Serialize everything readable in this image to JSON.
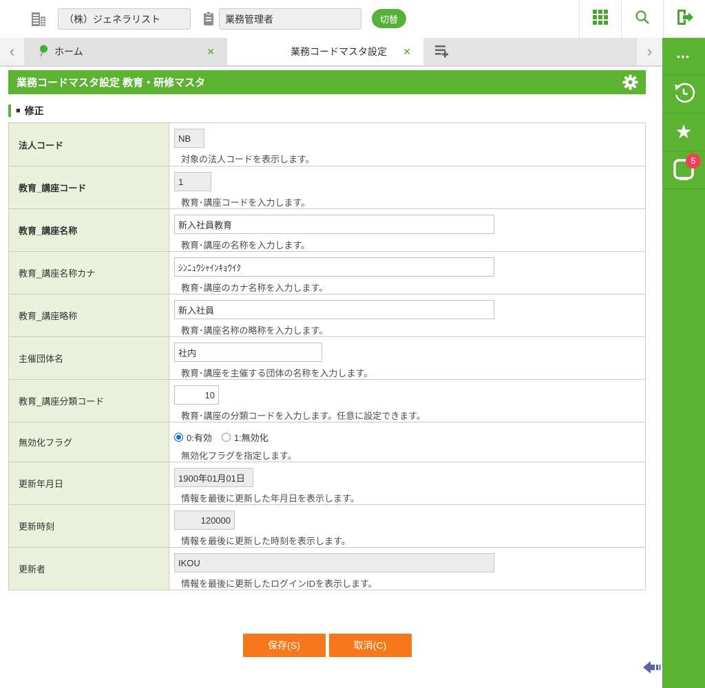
{
  "header": {
    "company_value": "（株）ジェネラリスト",
    "role_value": "業務管理者",
    "switch_label": "切替"
  },
  "tabs": {
    "home_label": "ホーム",
    "active_label": "業務コードマスタ設定"
  },
  "icons": {
    "close": "✕",
    "chevron_left": "‹",
    "chevron_right": "›",
    "more": "•••",
    "star": "★"
  },
  "titlebar": {
    "title": "業務コードマスタ設定 教育・研修マスタ"
  },
  "section": {
    "bullet": "■",
    "title": "修正"
  },
  "form": {
    "rows": [
      {
        "label": "法人コード",
        "value": "NB",
        "help": "対象の法人コードを表示します。"
      },
      {
        "label": "教育_講座コード",
        "value": "1",
        "help": "教育･講座コードを入力します。"
      },
      {
        "label": "教育_講座名称",
        "value": "新入社員教育",
        "help": "教育･講座の名称を入力します。"
      },
      {
        "label": "教育_講座名称カナ",
        "value": "ｼﾝﾆｭｳｼｬｲﾝｷｮｳｲｸ",
        "help": "教育･講座のカナ名称を入力します。"
      },
      {
        "label": "教育_講座略称",
        "value": "新入社員",
        "help": "教育･講座名称の略称を入力します。"
      },
      {
        "label": "主催団体名",
        "value": "社内",
        "help": "教育･講座を主催する団体の名称を入力します。"
      },
      {
        "label": "教育_講座分類コード",
        "value": "10",
        "help": "教育･講座の分類コードを入力します。任意に設定できます。"
      },
      {
        "label": "無効化フラグ",
        "selected": 0,
        "options": [
          {
            "label": "0:有効"
          },
          {
            "label": "1:無効化"
          }
        ],
        "help": "無効化フラグを指定します。"
      },
      {
        "label": "更新年月日",
        "value": "1900年01月01日",
        "help": "情報を最後に更新した年月日を表示します。"
      },
      {
        "label": "更新時刻",
        "value": "120000",
        "help": "情報を最後に更新した時刻を表示します。"
      },
      {
        "label": "更新者",
        "value": "IKOU",
        "help": "情報を最後に更新したログインIDを表示します。"
      }
    ]
  },
  "buttons": {
    "save": "保存(S)",
    "cancel": "取消(C)"
  },
  "sidebar": {
    "badge_count": "5"
  },
  "colors": {
    "brand_green": "#5cb231",
    "icon_green": "#4aa52e",
    "button_orange": "#f6771c",
    "badge_red": "#ef4155",
    "radio_blue": "#1b6fd8",
    "collapse_purple": "#5c63a5",
    "label_bg": "#e9f3dc"
  }
}
